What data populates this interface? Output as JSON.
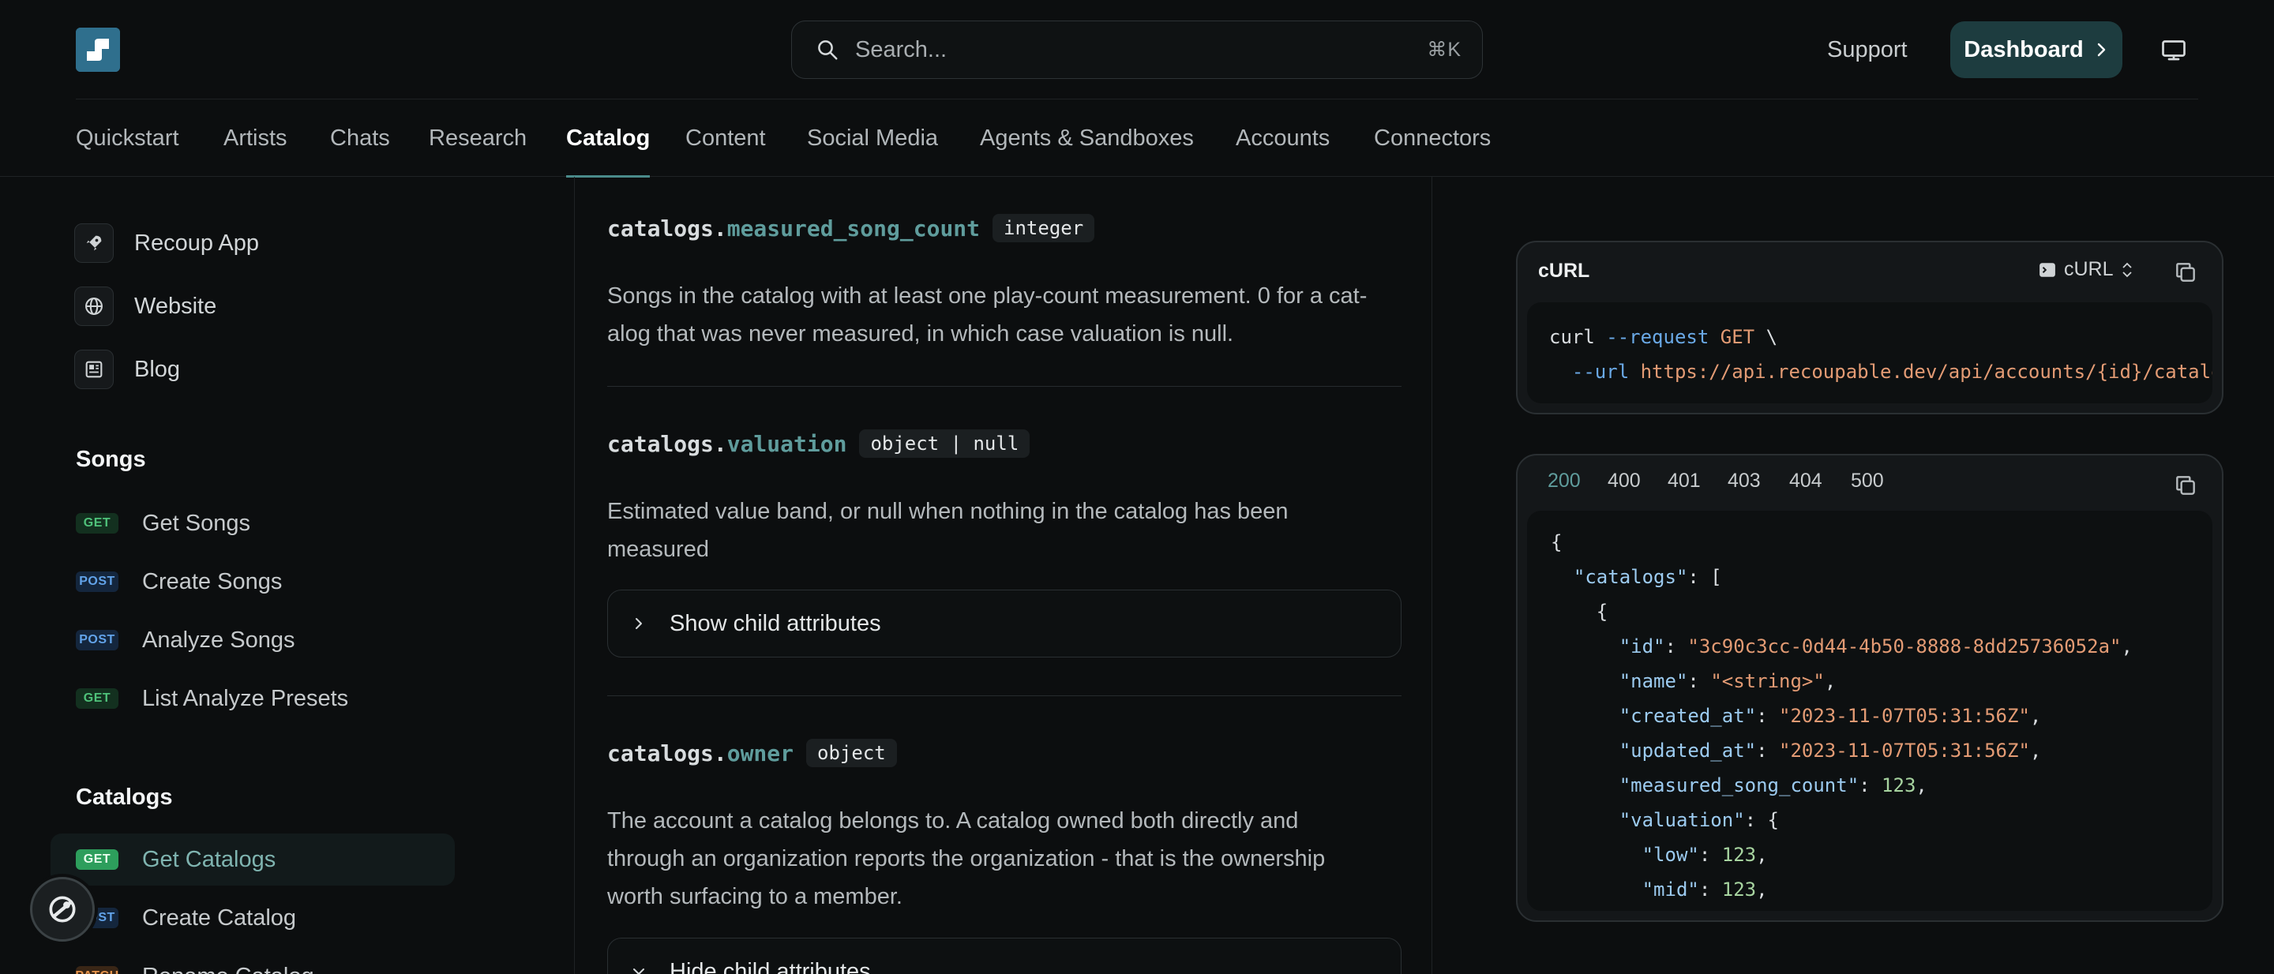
{
  "header": {
    "search_placeholder": "Search...",
    "search_shortcut": "⌘K",
    "support_label": "Support",
    "dashboard_label": "Dashboard"
  },
  "nav": {
    "tabs": [
      "Quickstart",
      "Artists",
      "Chats",
      "Research",
      "Catalog",
      "Content",
      "Social Media",
      "Agents & Sandboxes",
      "Accounts",
      "Connectors"
    ],
    "active": "Catalog"
  },
  "sidebar": {
    "links": [
      {
        "label": "Recoup App",
        "icon": "rocket-icon"
      },
      {
        "label": "Website",
        "icon": "globe-icon"
      },
      {
        "label": "Blog",
        "icon": "newspaper-icon"
      }
    ],
    "sections": [
      {
        "title": "Songs",
        "items": [
          {
            "method": "GET",
            "label": "Get Songs"
          },
          {
            "method": "POST",
            "label": "Create Songs"
          },
          {
            "method": "POST",
            "label": "Analyze Songs"
          },
          {
            "method": "GET",
            "label": "List Analyze Presets"
          }
        ]
      },
      {
        "title": "Catalogs",
        "items": [
          {
            "method": "GET",
            "label": "Get Catalogs",
            "active": true
          },
          {
            "method": "POST",
            "label": "Create Catalog"
          },
          {
            "method": "PATCH",
            "label": "Rename Catalog"
          }
        ]
      }
    ]
  },
  "main": {
    "fields": [
      {
        "prefix": "catalogs.",
        "name": "measured_song_count",
        "type": "integer",
        "description": [
          "Songs in the catalog with at least one play-count measurement. 0 for a cat-",
          "alog that was never measured, in which case valuation is null."
        ]
      },
      {
        "prefix": "catalogs.",
        "name": "valuation",
        "type": "object | null",
        "description": [
          "Estimated value band, or null when nothing in the catalog has been",
          "measured"
        ],
        "toggle": "Show child attributes"
      },
      {
        "prefix": "catalogs.",
        "name": "owner",
        "type": "object",
        "description": [
          "The account a catalog belongs to. A catalog owned both directly and",
          "through an organization reports the organization - that is the ownership",
          "worth surfacing to a member."
        ],
        "toggle": "Hide child attributes"
      }
    ]
  },
  "request_card": {
    "title": "cURL",
    "language_selector": "cURL",
    "line1": {
      "cmd": "curl",
      "flag": "--request",
      "method": "GET",
      "cont": "\\"
    },
    "line2": {
      "flag": "--url",
      "url": "https://api.recoupable.dev/api/accounts/{id}/catalogs"
    }
  },
  "response_card": {
    "status_tabs": [
      "200",
      "400",
      "401",
      "403",
      "404",
      "500"
    ],
    "active_status": "200",
    "json": {
      "root_key": "catalogs",
      "id": "3c90c3cc-0d44-4b50-8888-8dd25736052a",
      "name": "<string>",
      "created_at": "2023-11-07T05:31:56Z",
      "updated_at": "2023-11-07T05:31:56Z",
      "measured_song_count": "123",
      "valuation_key": "valuation",
      "low": "123",
      "mid": "123"
    }
  },
  "colors": {
    "accent": "#4a8a8a",
    "get": "#4fc27a",
    "post": "#62a3e9",
    "patch": "#e3924a",
    "button_bg": "#1d3c3f"
  }
}
